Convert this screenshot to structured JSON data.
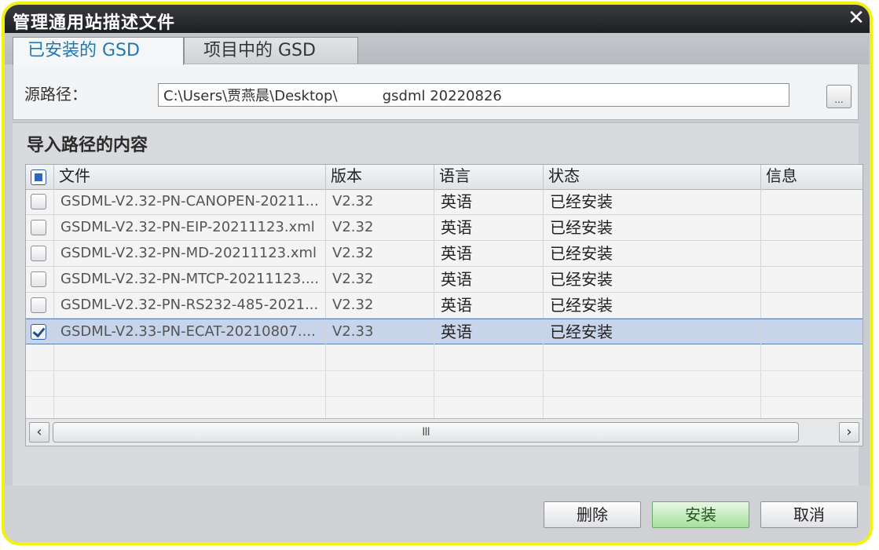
{
  "window": {
    "title": "管理通用站描述文件",
    "close_glyph": "✕"
  },
  "tabs": [
    {
      "label": "已安装的 GSD",
      "active": true
    },
    {
      "label": "项目中的 GSD",
      "active": false
    }
  ],
  "source": {
    "label": "源路径：",
    "value": "C:\\Users\\贾燕晨\\Desktop\\          gsdml 20220826",
    "browse_label": "..."
  },
  "section_title": "导入路径的内容",
  "table": {
    "columns": [
      "文件",
      "版本",
      "语言",
      "状态",
      "信息"
    ],
    "rows": [
      {
        "file": "GSDML-V2.32-PN-CANOPEN-20211...",
        "version": "V2.32",
        "language": "英语",
        "status": "已经安装",
        "info": "",
        "checked": false
      },
      {
        "file": "GSDML-V2.32-PN-EIP-20211123.xml",
        "version": "V2.32",
        "language": "英语",
        "status": "已经安装",
        "info": "",
        "checked": false
      },
      {
        "file": "GSDML-V2.32-PN-MD-20211123.xml",
        "version": "V2.32",
        "language": "英语",
        "status": "已经安装",
        "info": "",
        "checked": false
      },
      {
        "file": "GSDML-V2.32-PN-MTCP-20211123....",
        "version": "V2.32",
        "language": "英语",
        "status": "已经安装",
        "info": "",
        "checked": false
      },
      {
        "file": "GSDML-V2.32-PN-RS232-485-2021...",
        "version": "V2.32",
        "language": "英语",
        "status": "已经安装",
        "info": "",
        "checked": false
      },
      {
        "file": "GSDML-V2.33-PN-ECAT-20210807....",
        "version": "V2.33",
        "language": "英语",
        "status": "已经安装",
        "info": "",
        "checked": true
      }
    ]
  },
  "scrollbar": {
    "left": "‹",
    "right": "›",
    "thumb_grip": "III"
  },
  "buttons": {
    "delete": "删除",
    "install": "安装",
    "cancel": "取消"
  },
  "colors": {
    "accent": "#1e78b4",
    "highlight_border": "#f2f20c",
    "selected_row": "#c7d4ea"
  }
}
